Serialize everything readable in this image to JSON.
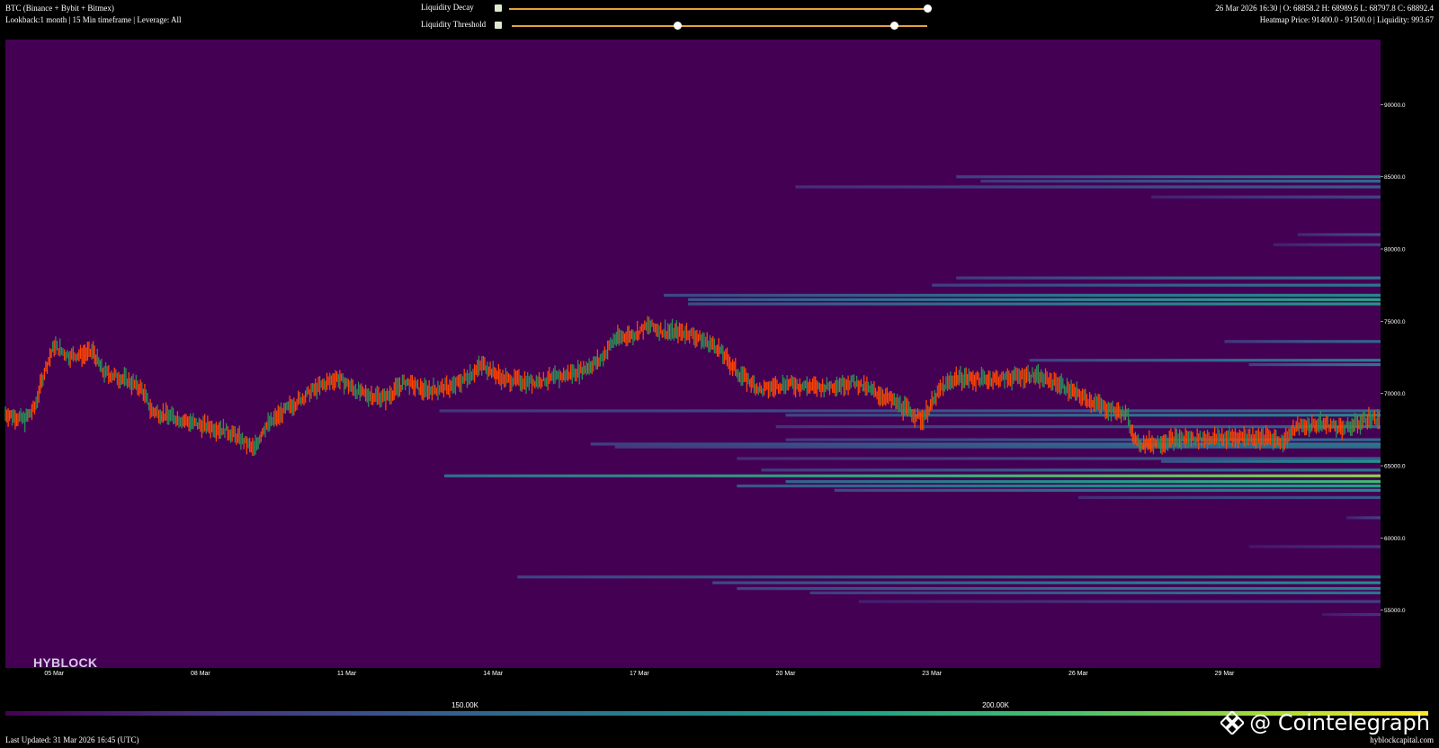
{
  "header": {
    "title": "BTC (Binance + Bybit + Bitmex)",
    "subtitle": "Lookback:1 month | 15 Min timeframe | Leverage: All",
    "ohlc": "26 Mar 2026 16:30 | O: 68858.2 H: 68989.6 L: 68797.8 C: 68892.4",
    "heatmap_info": "Heatmap Price: 91400.0 - 91500.0 | Liquidity: 993.67"
  },
  "controls": {
    "decay_label": "Liquidity Decay",
    "threshold_label": "Liquidity Threshold",
    "decay_value": 1.0,
    "threshold_range": [
      0.4,
      0.92
    ]
  },
  "brand": "HYBLOCK",
  "colorbar": {
    "ticks": [
      "150.00K",
      "200.00K"
    ]
  },
  "footer": {
    "updated": "Last Updated: 31 Mar 2026 16:45 (UTC)",
    "site": "hyblockcapital.com"
  },
  "watermark": "@ Cointelegraph",
  "colors": {
    "background": "#440154",
    "up": "#2e8b57",
    "down": "#ff4500",
    "accent": "#e3a23c"
  },
  "chart_data": {
    "type": "heatmap",
    "description_type": "candlestick",
    "ylim": [
      51000,
      94500
    ],
    "y_ticks": [
      55000,
      60000,
      65000,
      70000,
      75000,
      80000,
      85000,
      90000
    ],
    "y_tick_labels": [
      "55000.0",
      "60000.0",
      "65000.0",
      "70000.0",
      "75000.0",
      "80000.0",
      "85000.0",
      "90000.0"
    ],
    "x_range_days": [
      0,
      28.2
    ],
    "x_ticks": [
      {
        "day": 1,
        "label": "05 Mar"
      },
      {
        "day": 4,
        "label": "08 Mar"
      },
      {
        "day": 7,
        "label": "11 Mar"
      },
      {
        "day": 10,
        "label": "14 Mar"
      },
      {
        "day": 13,
        "label": "17 Mar"
      },
      {
        "day": 16,
        "label": "20 Mar"
      },
      {
        "day": 19,
        "label": "23 Mar"
      },
      {
        "day": 22,
        "label": "26 Mar"
      },
      {
        "day": 25,
        "label": "29 Mar"
      }
    ],
    "price_path": [
      [
        0.0,
        68600
      ],
      [
        0.4,
        68200
      ],
      [
        0.6,
        69000
      ],
      [
        0.8,
        71500
      ],
      [
        1.0,
        73300
      ],
      [
        1.3,
        72600
      ],
      [
        1.6,
        72700
      ],
      [
        1.8,
        72900
      ],
      [
        2.0,
        71500
      ],
      [
        2.5,
        70900
      ],
      [
        2.8,
        70300
      ],
      [
        3.0,
        68800
      ],
      [
        3.5,
        68300
      ],
      [
        4.0,
        67800
      ],
      [
        4.5,
        67500
      ],
      [
        4.8,
        66900
      ],
      [
        5.1,
        66100
      ],
      [
        5.3,
        67600
      ],
      [
        5.8,
        69000
      ],
      [
        6.3,
        70200
      ],
      [
        6.8,
        71100
      ],
      [
        7.3,
        70000
      ],
      [
        7.8,
        69700
      ],
      [
        8.2,
        70800
      ],
      [
        8.6,
        70200
      ],
      [
        9.2,
        70500
      ],
      [
        9.8,
        72000
      ],
      [
        10.2,
        71000
      ],
      [
        10.8,
        70800
      ],
      [
        11.3,
        71100
      ],
      [
        11.8,
        71600
      ],
      [
        12.2,
        72300
      ],
      [
        12.5,
        73800
      ],
      [
        12.9,
        74100
      ],
      [
        13.2,
        74700
      ],
      [
        13.5,
        74300
      ],
      [
        14.0,
        74200
      ],
      [
        14.6,
        73200
      ],
      [
        15.0,
        71500
      ],
      [
        15.5,
        70200
      ],
      [
        16.0,
        70700
      ],
      [
        16.7,
        70400
      ],
      [
        17.4,
        70800
      ],
      [
        18.2,
        69500
      ],
      [
        18.8,
        68200
      ],
      [
        19.2,
        70400
      ],
      [
        19.5,
        71100
      ],
      [
        19.9,
        71000
      ],
      [
        20.4,
        71000
      ],
      [
        21.0,
        71300
      ],
      [
        21.6,
        70700
      ],
      [
        22.0,
        69900
      ],
      [
        22.5,
        69100
      ],
      [
        23.0,
        68500
      ],
      [
        23.2,
        66500
      ],
      [
        23.6,
        66600
      ],
      [
        24.2,
        66900
      ],
      [
        24.8,
        66900
      ],
      [
        25.4,
        67000
      ],
      [
        26.0,
        66900
      ],
      [
        26.2,
        66700
      ],
      [
        26.5,
        67700
      ],
      [
        27.0,
        67900
      ],
      [
        27.5,
        67600
      ],
      [
        27.9,
        68200
      ],
      [
        28.2,
        68300
      ]
    ],
    "liquidity_bands": [
      {
        "price": 91400,
        "start": 28.2,
        "level": 0.9
      },
      {
        "price": 85000,
        "start": 19.5,
        "level": 0.42
      },
      {
        "price": 84700,
        "start": 20.0,
        "level": 0.35
      },
      {
        "price": 84300,
        "start": 16.2,
        "level": 0.3
      },
      {
        "price": 83600,
        "start": 23.5,
        "level": 0.22
      },
      {
        "price": 81000,
        "start": 26.5,
        "level": 0.25
      },
      {
        "price": 80300,
        "start": 26.0,
        "level": 0.2
      },
      {
        "price": 78000,
        "start": 19.5,
        "level": 0.4
      },
      {
        "price": 77500,
        "start": 19.0,
        "level": 0.42
      },
      {
        "price": 76800,
        "start": 13.5,
        "level": 0.5
      },
      {
        "price": 76500,
        "start": 14.0,
        "level": 0.62
      },
      {
        "price": 76200,
        "start": 14.0,
        "level": 0.55
      },
      {
        "price": 73600,
        "start": 25.0,
        "level": 0.35
      },
      {
        "price": 72300,
        "start": 21.0,
        "level": 0.45
      },
      {
        "price": 72000,
        "start": 25.5,
        "level": 0.42
      },
      {
        "price": 68800,
        "start": 8.9,
        "level": 0.35
      },
      {
        "price": 68500,
        "start": 16.0,
        "level": 0.48
      },
      {
        "price": 67700,
        "start": 15.8,
        "level": 0.32
      },
      {
        "price": 66800,
        "start": 16.0,
        "level": 0.35
      },
      {
        "price": 66500,
        "start": 12.0,
        "level": 0.42
      },
      {
        "price": 66300,
        "start": 12.5,
        "level": 0.38
      },
      {
        "price": 65500,
        "start": 15.0,
        "level": 0.3
      },
      {
        "price": 65300,
        "start": 23.7,
        "level": 0.55
      },
      {
        "price": 64700,
        "start": 15.5,
        "level": 0.4
      },
      {
        "price": 64300,
        "start": 9.0,
        "level": 0.85
      },
      {
        "price": 63900,
        "start": 16.0,
        "level": 0.72
      },
      {
        "price": 63600,
        "start": 15.0,
        "level": 0.6
      },
      {
        "price": 63300,
        "start": 17.0,
        "level": 0.5
      },
      {
        "price": 62800,
        "start": 22.0,
        "level": 0.28
      },
      {
        "price": 61400,
        "start": 27.5,
        "level": 0.2
      },
      {
        "price": 59400,
        "start": 25.5,
        "level": 0.15
      },
      {
        "price": 57300,
        "start": 10.5,
        "level": 0.45
      },
      {
        "price": 56900,
        "start": 14.5,
        "level": 0.5
      },
      {
        "price": 56500,
        "start": 15.0,
        "level": 0.45
      },
      {
        "price": 56200,
        "start": 16.5,
        "level": 0.4
      },
      {
        "price": 55600,
        "start": 17.5,
        "level": 0.2
      },
      {
        "price": 54700,
        "start": 27.0,
        "level": 0.15
      }
    ]
  }
}
